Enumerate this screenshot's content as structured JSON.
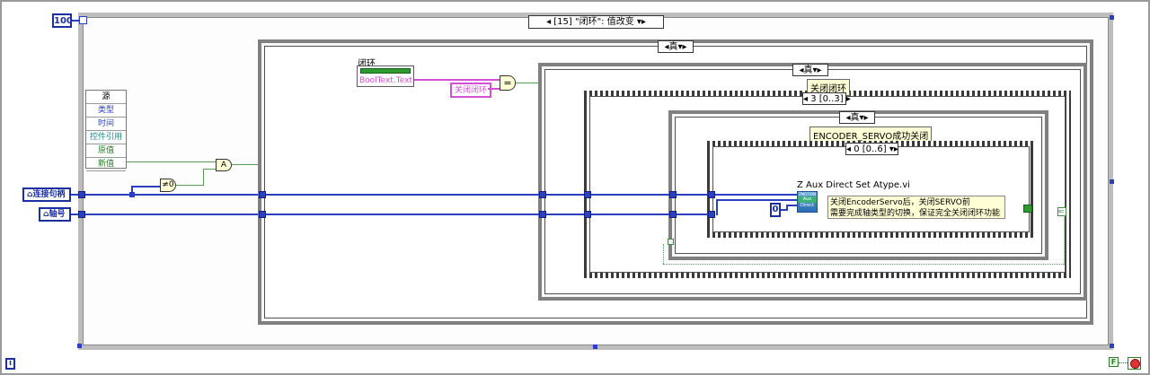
{
  "loop_count_label": "100",
  "event_case": {
    "selector": "[15] \"闭环\": 值改变"
  },
  "event_data_node": {
    "items": [
      "源",
      "类型",
      "时间",
      "控件引用",
      "原值",
      "新值"
    ]
  },
  "terminals": {
    "connection_handle": "连接句柄",
    "axis_number": "轴号",
    "close_loop_const": "关闭闭环",
    "zero_const": "0"
  },
  "close_loop_control": {
    "label": "闭环",
    "property": "BoolText.Text"
  },
  "case_outer": {
    "selector": "真"
  },
  "case_mid": {
    "selector": "真"
  },
  "sequence_mid": {
    "label": "关闭闭环",
    "selector": "3 [0..3]"
  },
  "case_inner": {
    "selector": "真"
  },
  "encoder_label": "ENCODER_SERVO成功关闭",
  "sequence_inner": {
    "selector": "0 [0..6]"
  },
  "subvi": {
    "name": "Z Aux Direct Set Atype.vi",
    "icon_top": "ZMOTION",
    "icon_mid": "Aux",
    "icon_bot": "Direct"
  },
  "comment": {
    "line1": "关闭EncoderServo后，关闭SERVO前",
    "line2": "需要完成轴类型的切换，保证完全关闭闭环功能"
  },
  "functions": {
    "and_symbol": "A",
    "not_equal_zero": "≠0",
    "equal_symbol": "="
  },
  "iteration_terminal": "i",
  "stop_terminal_glyph": "F"
}
